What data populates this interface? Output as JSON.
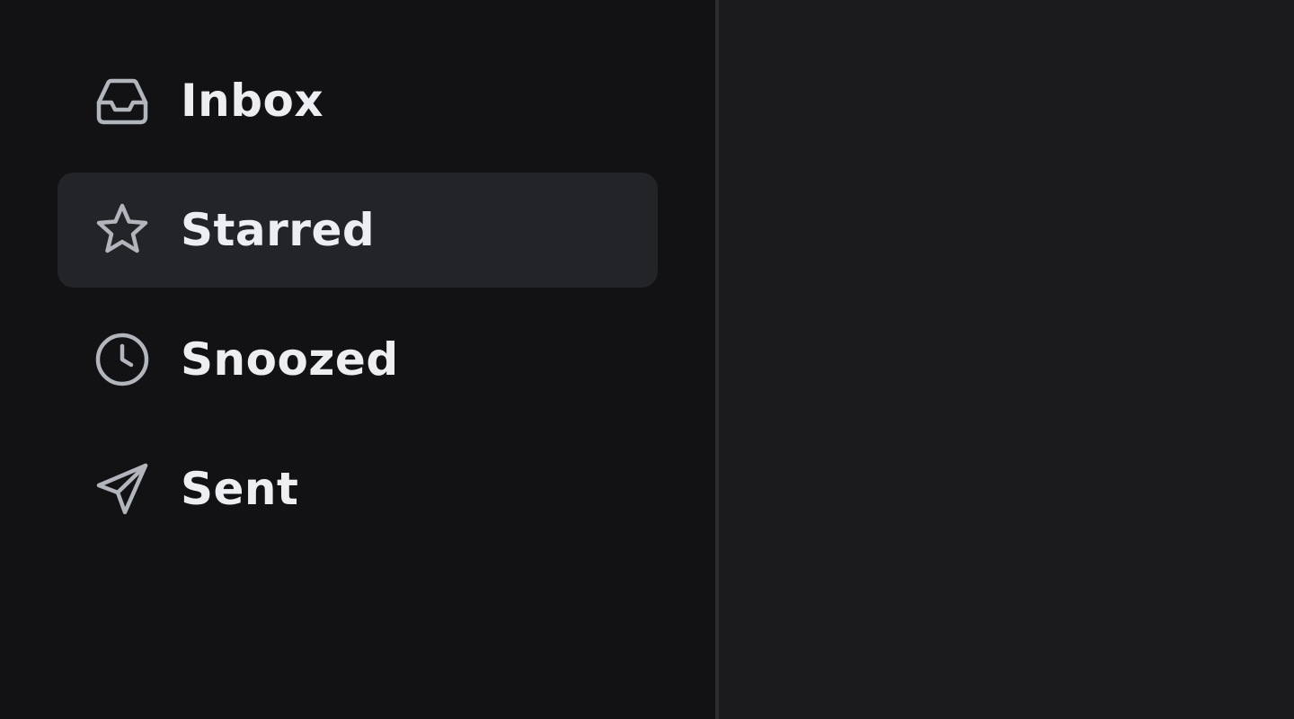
{
  "sidebar": {
    "items": [
      {
        "label": "Inbox",
        "icon": "inbox-icon",
        "active": false
      },
      {
        "label": "Starred",
        "icon": "star-icon",
        "active": true
      },
      {
        "label": "Snoozed",
        "icon": "clock-icon",
        "active": false
      },
      {
        "label": "Sent",
        "icon": "send-icon",
        "active": false
      }
    ]
  },
  "colors": {
    "sidebar_background": "#121214",
    "main_background": "#1b1b1e",
    "active_item_background": "#232428",
    "icon_stroke": "#b3b5bd",
    "label_text": "#eceef2",
    "divider": "#2c2c31"
  }
}
